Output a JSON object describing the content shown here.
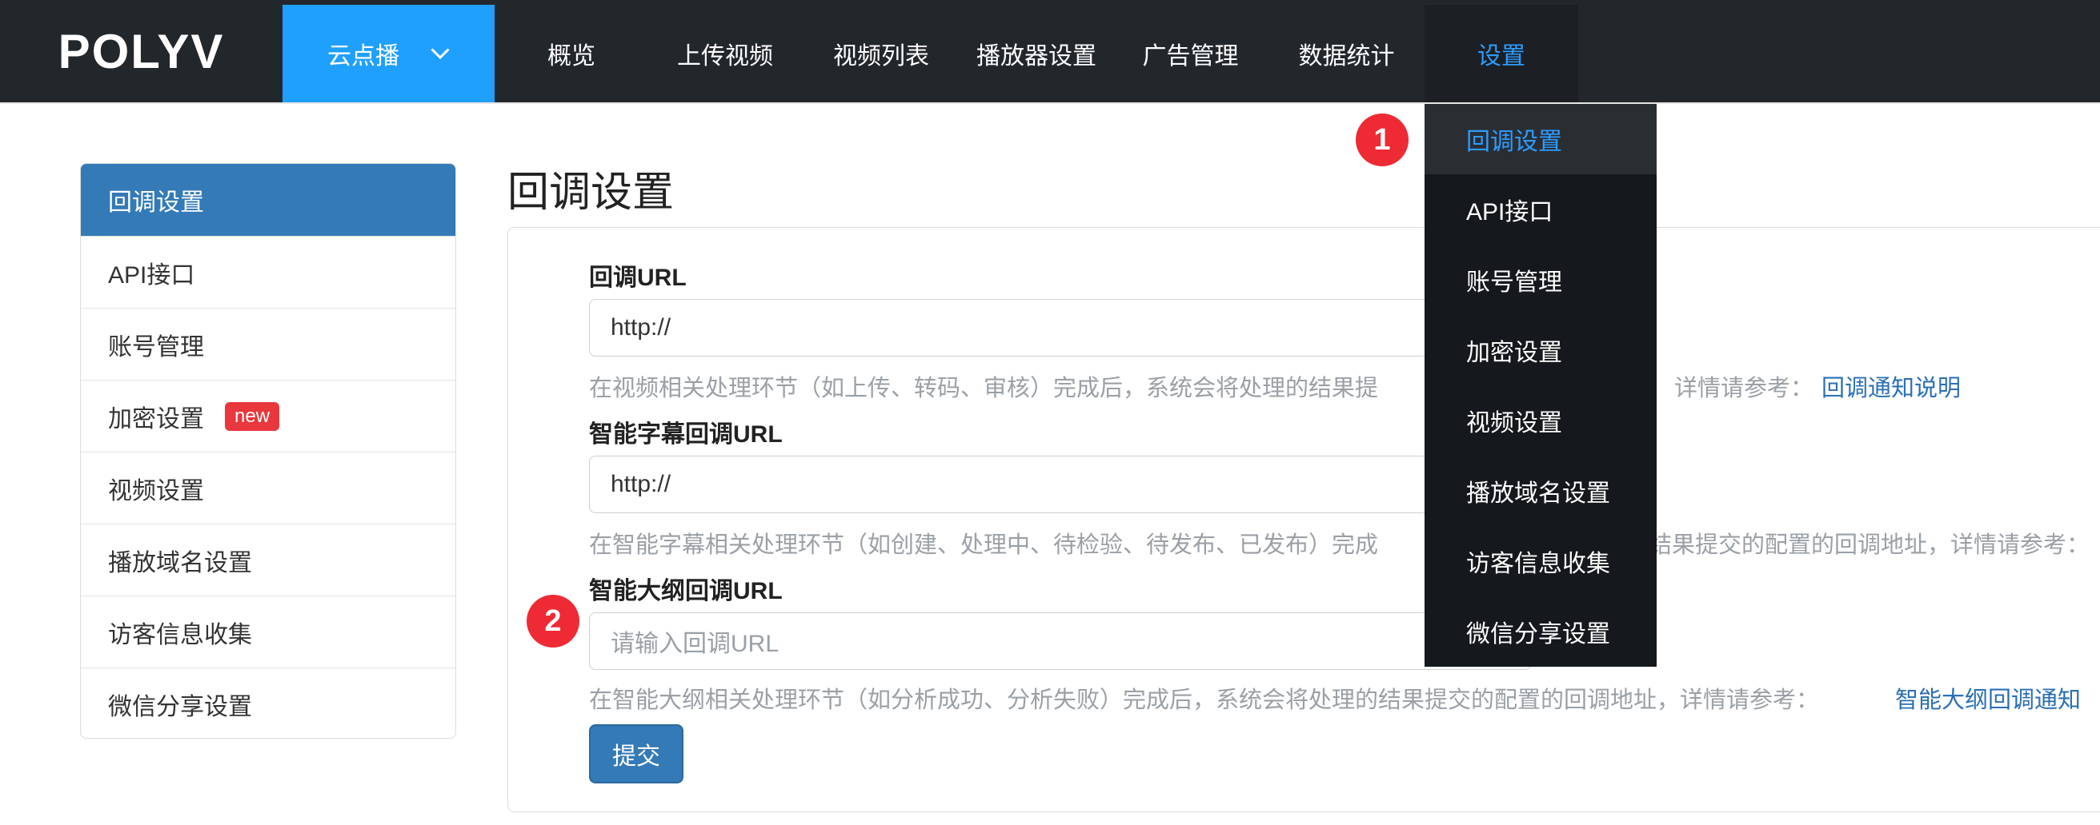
{
  "header": {
    "logo": "POLYV",
    "product_switcher": "云点播",
    "nav": [
      "概览",
      "上传视频",
      "视频列表",
      "播放器设置",
      "广告管理",
      "数据统计",
      "设置"
    ],
    "active_nav": "设置"
  },
  "dropdown": {
    "items": [
      "回调设置",
      "API接口",
      "账号管理",
      "加密设置",
      "视频设置",
      "播放域名设置",
      "访客信息收集",
      "微信分享设置"
    ],
    "active": "回调设置"
  },
  "sidebar": {
    "items": [
      "回调设置",
      "API接口",
      "账号管理",
      "加密设置",
      "视频设置",
      "播放域名设置",
      "访客信息收集",
      "微信分享设置"
    ],
    "active": "回调设置",
    "badge_new": "new"
  },
  "main": {
    "title": "回调设置",
    "fields": [
      {
        "label": "回调URL",
        "value": "http://",
        "help_left": "在视频相关处理环节（如上传、转码、审核）完成后，系统会将处理的结果提",
        "help_right": "详情请参考：",
        "link": "回调通知说明"
      },
      {
        "label": "智能字幕回调URL",
        "value": "http://",
        "help_left": "在智能字幕相关处理环节（如创建、处理中、待检验、待发布、已发布）完成",
        "help_right": "结果提交的配置的回调地址，详情请参考："
      },
      {
        "label": "智能大纲回调URL",
        "placeholder": "请输入回调URL",
        "help_left": "在智能大纲相关处理环节（如分析成功、分析失败）完成后，系统会将处理的结果提交的配置的回调地址，详情请参考：",
        "link": "智能大纲回调通知"
      }
    ],
    "submit": "提交"
  },
  "annotations": [
    "1",
    "2"
  ],
  "colors": {
    "topbar": "#22272c",
    "product_blue": "#1fa0ff",
    "active_blue": "#337ab7",
    "link_blue": "#2a6fb5",
    "marker_red": "#ee2b35",
    "badge_red": "#e8373d"
  }
}
